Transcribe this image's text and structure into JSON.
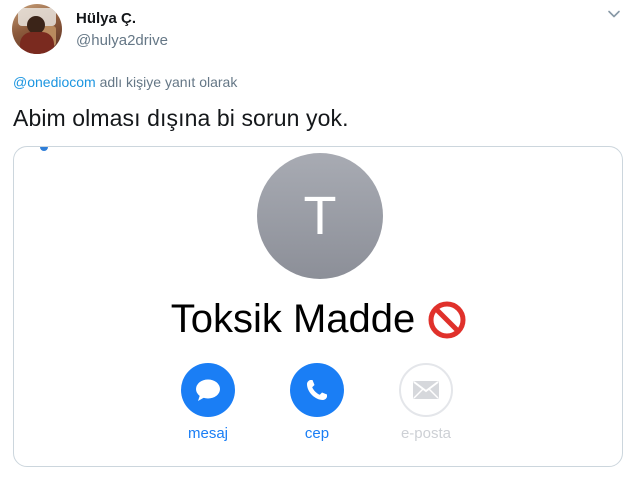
{
  "author": {
    "name": "Hülya Ç.",
    "handle": "@hulya2drive"
  },
  "reply": {
    "mention": "@onediocom",
    "suffix": "adlı kişiye yanıt olarak"
  },
  "tweet_text": "Abim olması dışına bi sorun yok.",
  "contact": {
    "initial": "T",
    "name": "Toksik Madde",
    "actions": [
      {
        "label": "mesaj",
        "icon": "message-bubble-icon",
        "enabled": true
      },
      {
        "label": "cep",
        "icon": "phone-icon",
        "enabled": true
      },
      {
        "label": "e-posta",
        "icon": "mail-envelope-icon",
        "enabled": false
      }
    ]
  },
  "colors": {
    "link": "#1b95e0",
    "ios_blue": "#1a7ef5",
    "muted": "#657786",
    "avatar_gray": "#9a9da5"
  }
}
